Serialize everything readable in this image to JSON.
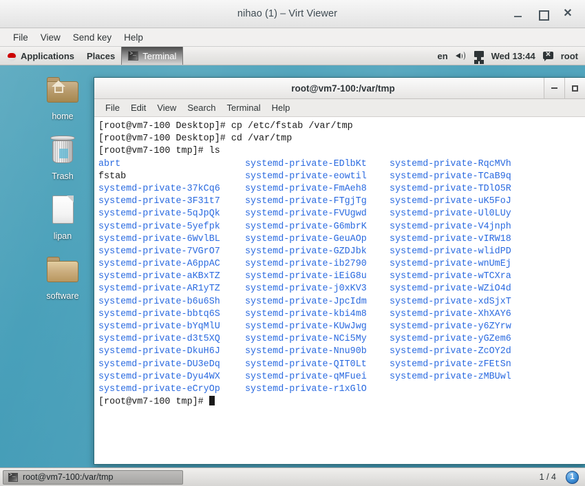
{
  "viewer": {
    "title": "nihao (1) – Virt Viewer",
    "menus": [
      "File",
      "View",
      "Send key",
      "Help"
    ],
    "window_buttons": {
      "minimize": "–",
      "maximize": "□",
      "close": "✕"
    }
  },
  "panel": {
    "logo_icon": "redhat-logo-icon",
    "applications": "Applications",
    "places": "Places",
    "active_window": "Terminal",
    "keyboard_layout": "en",
    "speaker_icon": "volume-icon",
    "display_icon": "display-icon",
    "clock": "Wed 13:44",
    "user_icon": "message-icon",
    "user": "root"
  },
  "desktop": {
    "icons": [
      {
        "label": "home",
        "icon": "home-folder-icon"
      },
      {
        "label": "Trash",
        "icon": "trash-icon"
      },
      {
        "label": "lipan",
        "icon": "document-icon"
      },
      {
        "label": "software",
        "icon": "folder-icon"
      }
    ]
  },
  "terminal": {
    "title": "root@vm7-100:/var/tmp",
    "menus": [
      "File",
      "Edit",
      "View",
      "Search",
      "Terminal",
      "Help"
    ],
    "window_buttons": {
      "minimize": "–",
      "maximize": "□"
    },
    "prompt_lines": [
      "[root@vm7-100 Desktop]# cp /etc/fstab /var/tmp",
      "[root@vm7-100 Desktop]# cd /var/tmp",
      "[root@vm7-100 tmp]# ls"
    ],
    "final_prompt": "[root@vm7-100 tmp]# ",
    "colors": {
      "directory": "#2a6ae0",
      "file": "#1a1a1a",
      "background": "#ffffff"
    },
    "listing": {
      "columns": [
        [
          {
            "name": "abrt",
            "type": "dir"
          },
          {
            "name": "fstab",
            "type": "file"
          },
          {
            "name": "systemd-private-37kCq6",
            "type": "dir"
          },
          {
            "name": "systemd-private-3F31t7",
            "type": "dir"
          },
          {
            "name": "systemd-private-5qJpQk",
            "type": "dir"
          },
          {
            "name": "systemd-private-5yefpk",
            "type": "dir"
          },
          {
            "name": "systemd-private-6WvlBL",
            "type": "dir"
          },
          {
            "name": "systemd-private-7VGrO7",
            "type": "dir"
          },
          {
            "name": "systemd-private-A6ppAC",
            "type": "dir"
          },
          {
            "name": "systemd-private-aKBxTZ",
            "type": "dir"
          },
          {
            "name": "systemd-private-AR1yTZ",
            "type": "dir"
          },
          {
            "name": "systemd-private-b6u6Sh",
            "type": "dir"
          },
          {
            "name": "systemd-private-bbtq6S",
            "type": "dir"
          },
          {
            "name": "systemd-private-bYqMlU",
            "type": "dir"
          },
          {
            "name": "systemd-private-d3t5XQ",
            "type": "dir"
          },
          {
            "name": "systemd-private-DkuH6J",
            "type": "dir"
          },
          {
            "name": "systemd-private-DU3eDq",
            "type": "dir"
          },
          {
            "name": "systemd-private-Dyu4WX",
            "type": "dir"
          },
          {
            "name": "systemd-private-eCryOp",
            "type": "dir"
          }
        ],
        [
          {
            "name": "systemd-private-EDlbKt",
            "type": "dir"
          },
          {
            "name": "systemd-private-eowtil",
            "type": "dir"
          },
          {
            "name": "systemd-private-FmAeh8",
            "type": "dir"
          },
          {
            "name": "systemd-private-FTgjTg",
            "type": "dir"
          },
          {
            "name": "systemd-private-FVUgwd",
            "type": "dir"
          },
          {
            "name": "systemd-private-G6mbrK",
            "type": "dir"
          },
          {
            "name": "systemd-private-GeuAOp",
            "type": "dir"
          },
          {
            "name": "systemd-private-GZDJbk",
            "type": "dir"
          },
          {
            "name": "systemd-private-ib2790",
            "type": "dir"
          },
          {
            "name": "systemd-private-iEiG8u",
            "type": "dir"
          },
          {
            "name": "systemd-private-j0xKV3",
            "type": "dir"
          },
          {
            "name": "systemd-private-JpcIdm",
            "type": "dir"
          },
          {
            "name": "systemd-private-kbi4m8",
            "type": "dir"
          },
          {
            "name": "systemd-private-KUwJwg",
            "type": "dir"
          },
          {
            "name": "systemd-private-NCi5My",
            "type": "dir"
          },
          {
            "name": "systemd-private-Nnu90b",
            "type": "dir"
          },
          {
            "name": "systemd-private-QIT0Lt",
            "type": "dir"
          },
          {
            "name": "systemd-private-qMFuei",
            "type": "dir"
          },
          {
            "name": "systemd-private-r1xGlO",
            "type": "dir"
          }
        ],
        [
          {
            "name": "systemd-private-RqcMVh",
            "type": "dir"
          },
          {
            "name": "systemd-private-TCaB9q",
            "type": "dir"
          },
          {
            "name": "systemd-private-TDlO5R",
            "type": "dir"
          },
          {
            "name": "systemd-private-uK5FoJ",
            "type": "dir"
          },
          {
            "name": "systemd-private-Ul0LUy",
            "type": "dir"
          },
          {
            "name": "systemd-private-V4jnph",
            "type": "dir"
          },
          {
            "name": "systemd-private-vIRW18",
            "type": "dir"
          },
          {
            "name": "systemd-private-wlidPD",
            "type": "dir"
          },
          {
            "name": "systemd-private-wnUmEj",
            "type": "dir"
          },
          {
            "name": "systemd-private-wTCXra",
            "type": "dir"
          },
          {
            "name": "systemd-private-WZiO4d",
            "type": "dir"
          },
          {
            "name": "systemd-private-xdSjxT",
            "type": "dir"
          },
          {
            "name": "systemd-private-XhXAY6",
            "type": "dir"
          },
          {
            "name": "systemd-private-y6ZYrw",
            "type": "dir"
          },
          {
            "name": "systemd-private-yGZem6",
            "type": "dir"
          },
          {
            "name": "systemd-private-ZcOY2d",
            "type": "dir"
          },
          {
            "name": "systemd-private-zFEtSn",
            "type": "dir"
          },
          {
            "name": "systemd-private-zMBUwl",
            "type": "dir"
          }
        ]
      ]
    }
  },
  "taskbar": {
    "window_button": "root@vm7-100:/var/tmp",
    "window_icon": "terminal-icon",
    "workspace_indicator": "1 / 4",
    "workspace_badge": "1"
  }
}
